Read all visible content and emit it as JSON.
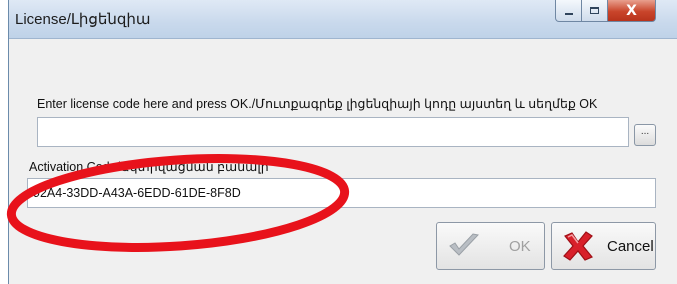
{
  "window": {
    "title": "License/Լիցենզիա"
  },
  "license_field": {
    "label": "Enter license code here and press OK./Մուտքագրեք լիցենզիայի կոդը այստեղ և սեղմեք OK",
    "value": "",
    "browse_label": "..."
  },
  "activation_field": {
    "label": "Activation Code/Ակտիվացման բանալի",
    "value": "92A4-33DD-A43A-6EDD-61DE-8F8D"
  },
  "buttons": {
    "ok_label": "OK",
    "cancel_label": "Cancel"
  },
  "icons": {
    "ok": "checkmark-icon",
    "cancel": "red-x-icon",
    "minimize": "minimize-icon",
    "maximize": "maximize-icon",
    "close": "close-icon"
  },
  "colors": {
    "annotation_circle": "#e8121b",
    "close_button": "#c9452b"
  }
}
